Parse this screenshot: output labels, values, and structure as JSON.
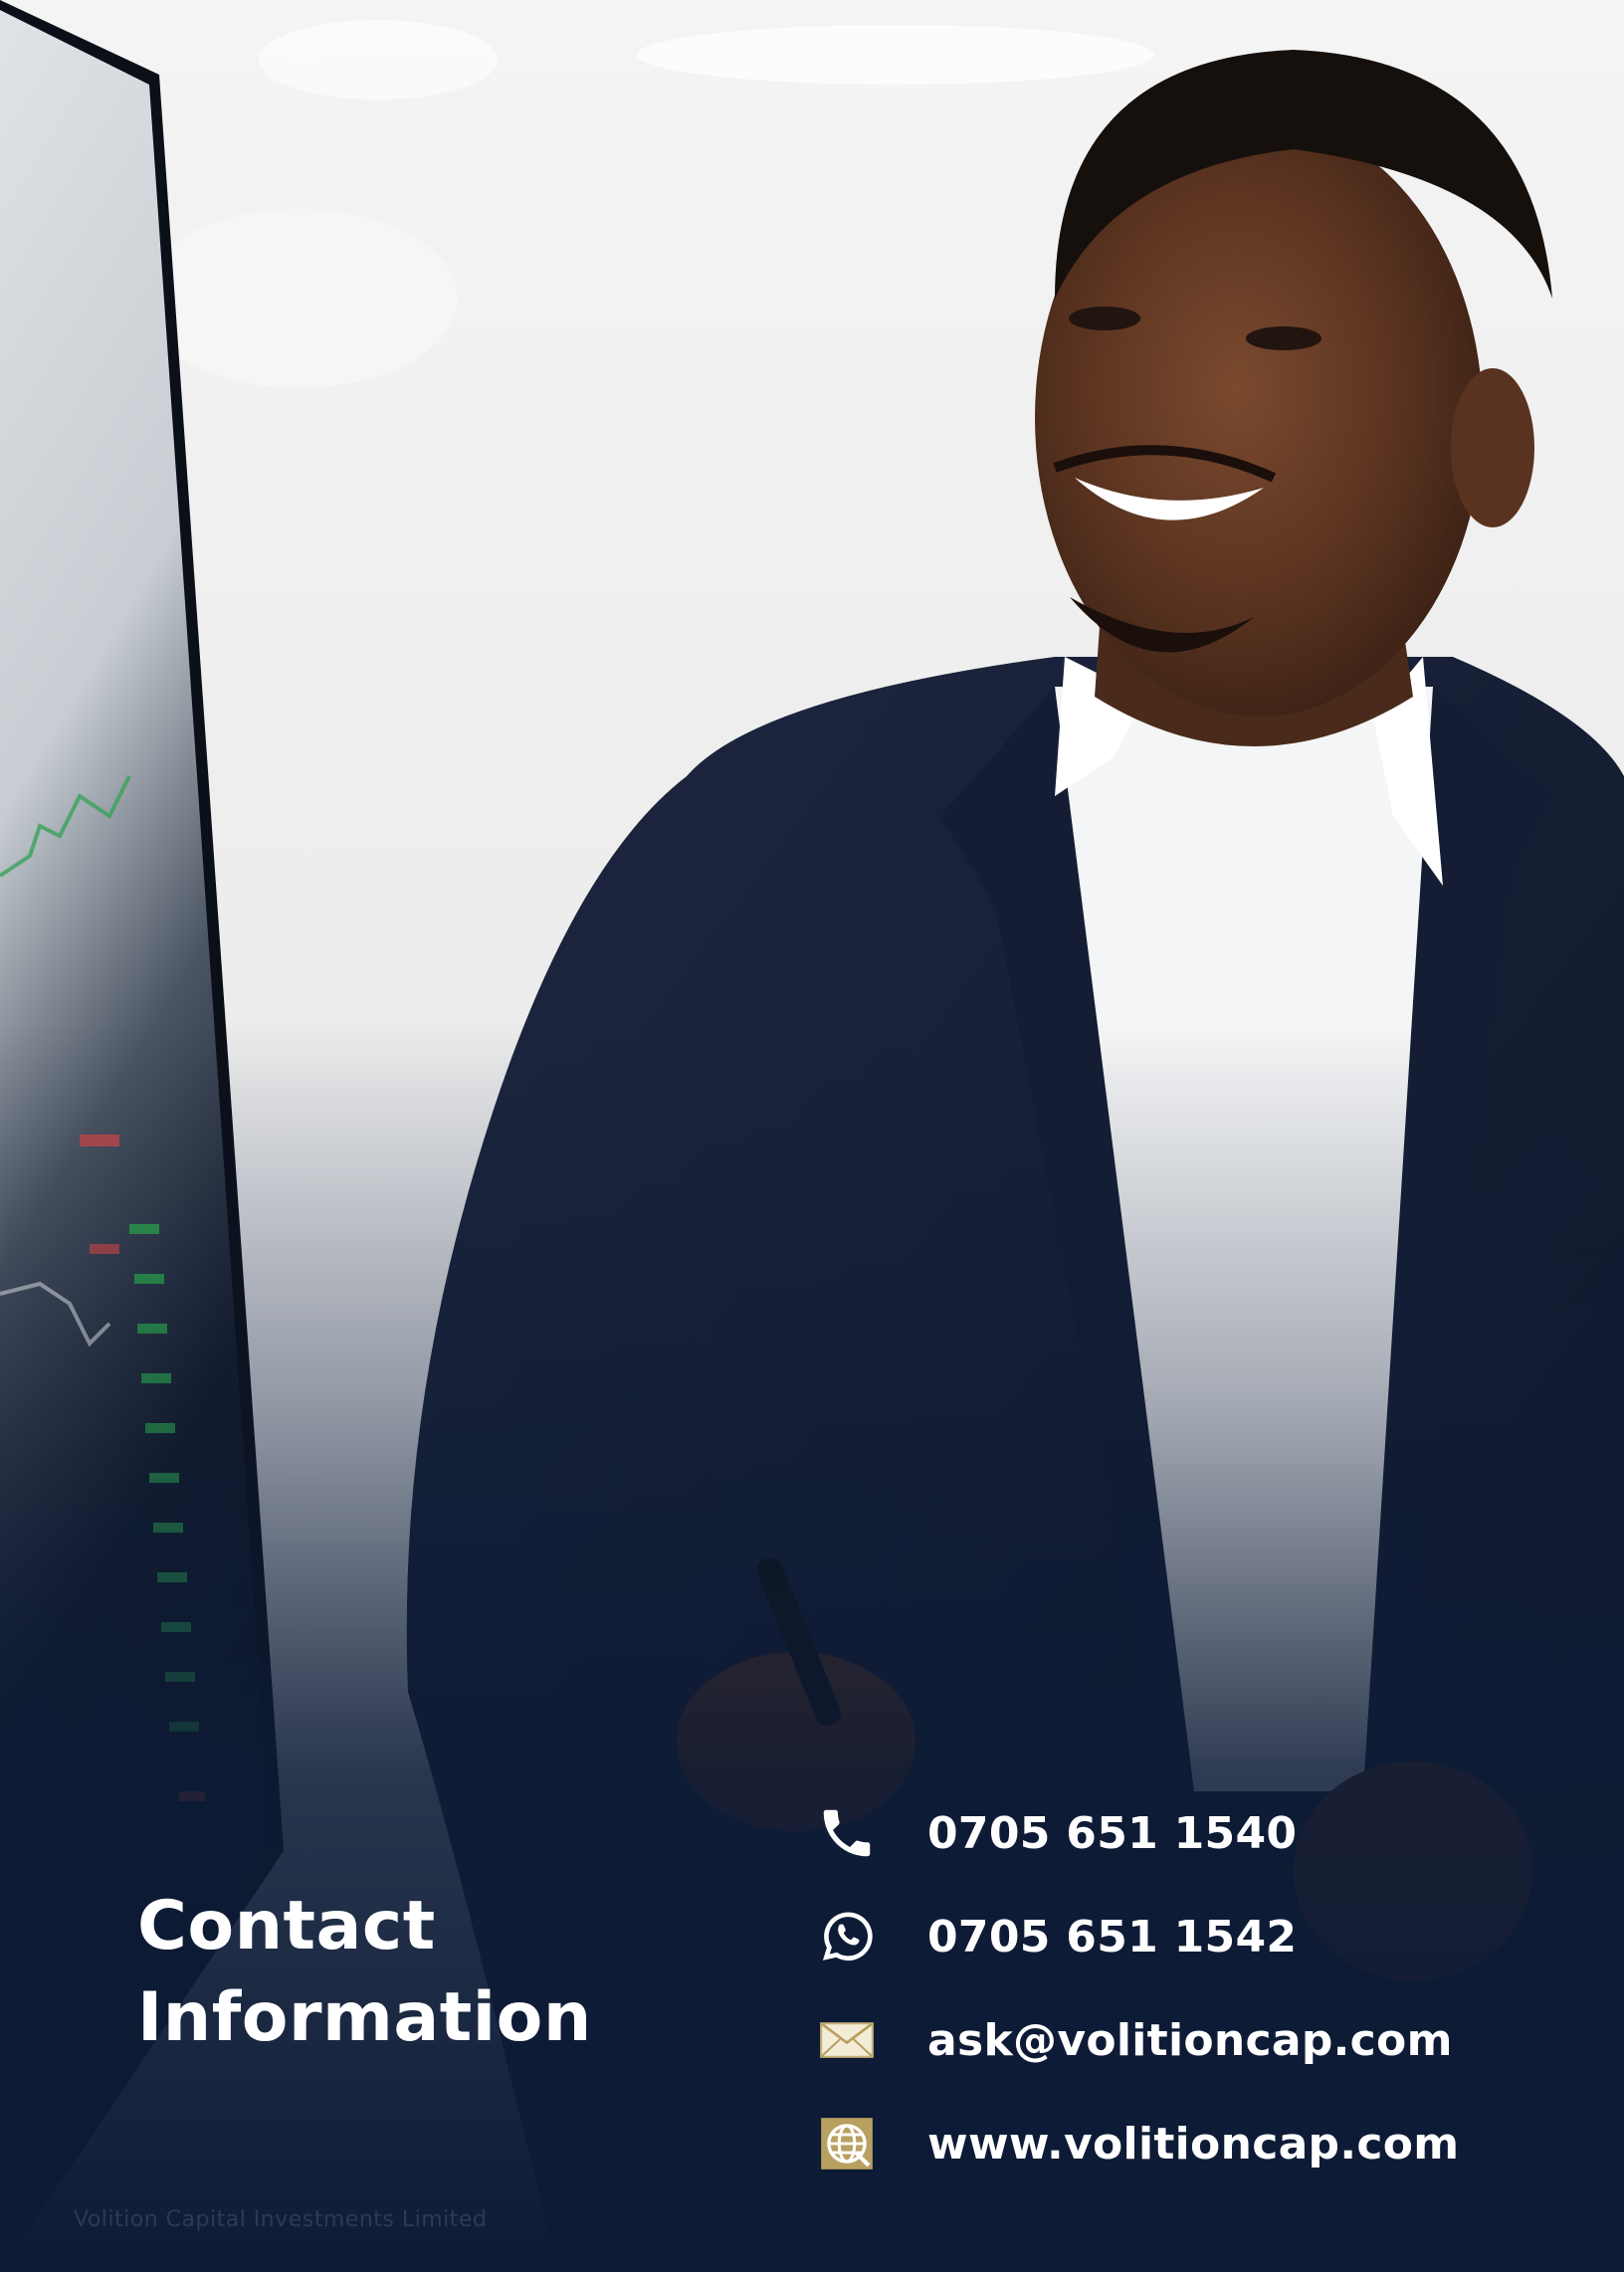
{
  "heading": {
    "line1": "Contact",
    "line2": "Information"
  },
  "contacts": [
    {
      "icon": "phone-icon",
      "text": "0705 651 1540"
    },
    {
      "icon": "whatsapp-icon",
      "text": "0705 651 1542"
    },
    {
      "icon": "email-icon",
      "text": "ask@volitioncap.com"
    },
    {
      "icon": "globe-icon",
      "text": "www.volitioncap.com"
    }
  ],
  "footer": {
    "company": "Volition Capital Investments Limited"
  },
  "colors": {
    "navy": "#0d1b36",
    "gold": "#b8a060",
    "white": "#ffffff"
  }
}
